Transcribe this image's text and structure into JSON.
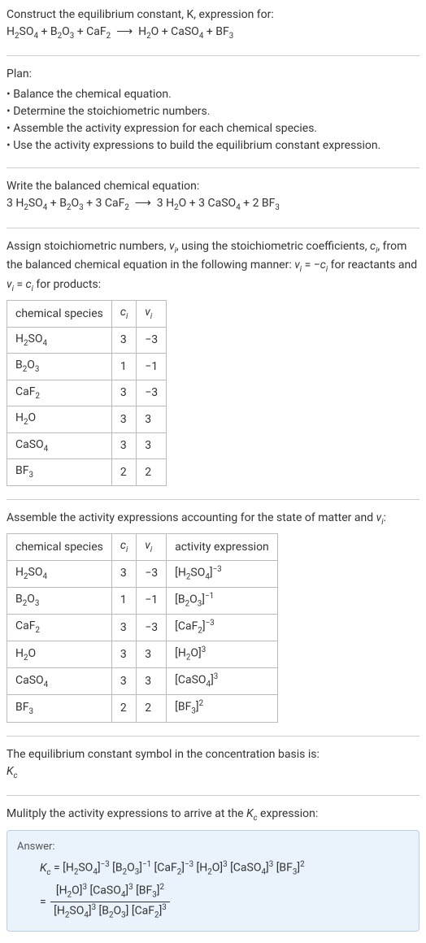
{
  "intro": {
    "line1": "Construct the equilibrium constant, K, expression for:",
    "equation_html": "H<span class=\"sub\">2</span>SO<span class=\"sub\">4</span> + B<span class=\"sub\">2</span>O<span class=\"sub\">3</span> + CaF<span class=\"sub\">2</span> &nbsp;⟶&nbsp; H<span class=\"sub\">2</span>O + CaSO<span class=\"sub\">4</span> + BF<span class=\"sub\">3</span>"
  },
  "plan": {
    "heading": "Plan:",
    "items": [
      "Balance the chemical equation.",
      "Determine the stoichiometric numbers.",
      "Assemble the activity expression for each chemical species.",
      "Use the activity expressions to build the equilibrium constant expression."
    ]
  },
  "balanced": {
    "heading": "Write the balanced chemical equation:",
    "equation_html": "3 H<span class=\"sub\">2</span>SO<span class=\"sub\">4</span> + B<span class=\"sub\">2</span>O<span class=\"sub\">3</span> + 3 CaF<span class=\"sub\">2</span> &nbsp;⟶&nbsp; 3 H<span class=\"sub\">2</span>O + 3 CaSO<span class=\"sub\">4</span> + 2 BF<span class=\"sub\">3</span>"
  },
  "stoich": {
    "heading_html": "Assign stoichiometric numbers, <i>ν<span class=\"sub\">i</span></i>, using the stoichiometric coefficients, <i>c<span class=\"sub\">i</span></i>, from the balanced chemical equation in the following manner: <i>ν<span class=\"sub\">i</span></i> = −<i>c<span class=\"sub\">i</span></i> for reactants and <i>ν<span class=\"sub\">i</span></i> = <i>c<span class=\"sub\">i</span></i> for products:",
    "cols": {
      "species": "chemical species",
      "c_html": "<i>c<span class=\"sub\">i</span></i>",
      "v_html": "<i>ν<span class=\"sub\">i</span></i>"
    },
    "rows": [
      {
        "sp_html": "H<span class=\"sub\">2</span>SO<span class=\"sub\">4</span>",
        "c": "3",
        "v": "−3"
      },
      {
        "sp_html": "B<span class=\"sub\">2</span>O<span class=\"sub\">3</span>",
        "c": "1",
        "v": "−1"
      },
      {
        "sp_html": "CaF<span class=\"sub\">2</span>",
        "c": "3",
        "v": "−3"
      },
      {
        "sp_html": "H<span class=\"sub\">2</span>O",
        "c": "3",
        "v": "3"
      },
      {
        "sp_html": "CaSO<span class=\"sub\">4</span>",
        "c": "3",
        "v": "3"
      },
      {
        "sp_html": "BF<span class=\"sub\">3</span>",
        "c": "2",
        "v": "2"
      }
    ]
  },
  "activity": {
    "heading_html": "Assemble the activity expressions accounting for the state of matter and <i>ν<span class=\"sub\">i</span></i>:",
    "cols": {
      "species": "chemical species",
      "c_html": "<i>c<span class=\"sub\">i</span></i>",
      "v_html": "<i>ν<span class=\"sub\">i</span></i>",
      "act": "activity expression"
    },
    "rows": [
      {
        "sp_html": "H<span class=\"sub\">2</span>SO<span class=\"sub\">4</span>",
        "c": "3",
        "v": "−3",
        "act_html": "[H<span class=\"sub\">2</span>SO<span class=\"sub\">4</span>]<span class=\"sup\">−3</span>"
      },
      {
        "sp_html": "B<span class=\"sub\">2</span>O<span class=\"sub\">3</span>",
        "c": "1",
        "v": "−1",
        "act_html": "[B<span class=\"sub\">2</span>O<span class=\"sub\">3</span>]<span class=\"sup\">−1</span>"
      },
      {
        "sp_html": "CaF<span class=\"sub\">2</span>",
        "c": "3",
        "v": "−3",
        "act_html": "[CaF<span class=\"sub\">2</span>]<span class=\"sup\">−3</span>"
      },
      {
        "sp_html": "H<span class=\"sub\">2</span>O",
        "c": "3",
        "v": "3",
        "act_html": "[H<span class=\"sub\">2</span>O]<span class=\"sup\">3</span>"
      },
      {
        "sp_html": "CaSO<span class=\"sub\">4</span>",
        "c": "3",
        "v": "3",
        "act_html": "[CaSO<span class=\"sub\">4</span>]<span class=\"sup\">3</span>"
      },
      {
        "sp_html": "BF<span class=\"sub\">3</span>",
        "c": "2",
        "v": "2",
        "act_html": "[BF<span class=\"sub\">3</span>]<span class=\"sup\">2</span>"
      }
    ]
  },
  "ksymbol": {
    "line": "The equilibrium constant symbol in the concentration basis is:",
    "symbol_html": "<i>K<span class=\"sub\">c</span></i>"
  },
  "final": {
    "heading_html": "Mulitply the activity expressions to arrive at the <i>K<span class=\"sub\">c</span></i> expression:",
    "answer_label": "Answer:",
    "expr_line_html": "<i>K<span class=\"sub\">c</span></i> = [H<span class=\"sub\">2</span>SO<span class=\"sub\">4</span>]<span class=\"sup\">−3</span> [B<span class=\"sub\">2</span>O<span class=\"sub\">3</span>]<span class=\"sup\">−1</span> [CaF<span class=\"sub\">2</span>]<span class=\"sup\">−3</span> [H<span class=\"sub\">2</span>O]<span class=\"sup\">3</span> [CaSO<span class=\"sub\">4</span>]<span class=\"sup\">3</span> [BF<span class=\"sub\">3</span>]<span class=\"sup\">2</span>",
    "frac_num_html": "[H<span class=\"sub\">2</span>O]<span class=\"sup\">3</span> [CaSO<span class=\"sub\">4</span>]<span class=\"sup\">3</span> [BF<span class=\"sub\">3</span>]<span class=\"sup\">2</span>",
    "frac_den_html": "[H<span class=\"sub\">2</span>SO<span class=\"sub\">4</span>]<span class=\"sup\">3</span> [B<span class=\"sub\">2</span>O<span class=\"sub\">3</span>] [CaF<span class=\"sub\">2</span>]<span class=\"sup\">3</span>"
  }
}
